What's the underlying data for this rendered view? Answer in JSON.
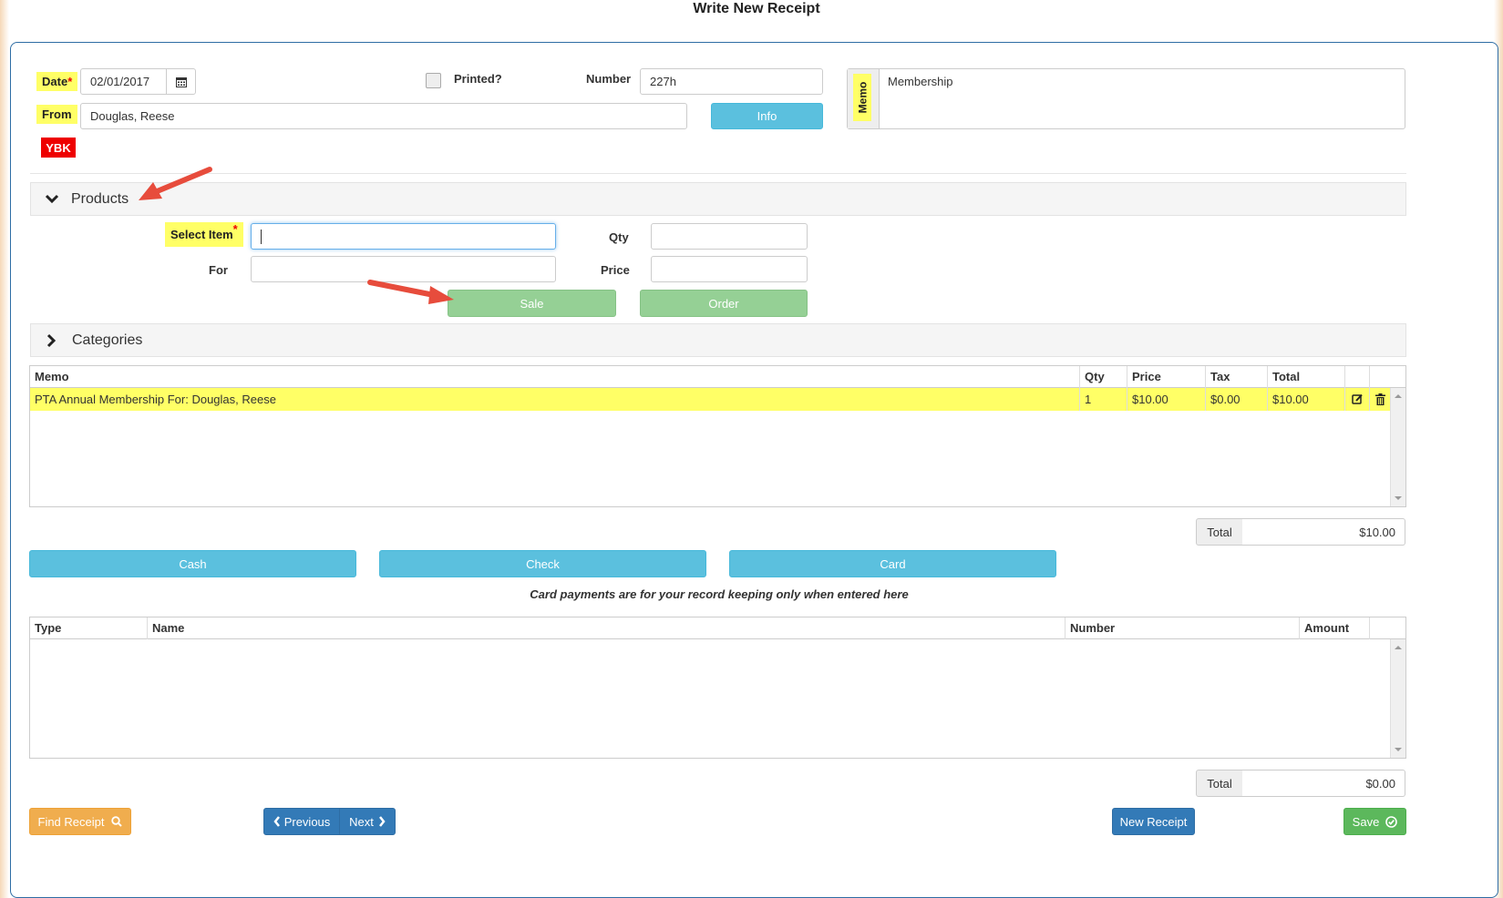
{
  "page": {
    "title": "Write New Receipt"
  },
  "header": {
    "date_label": "Date",
    "date_value": "02/01/2017",
    "from_label": "From",
    "from_value": "Douglas, Reese",
    "badge": "YBK",
    "printed_label": "Printed?",
    "printed_checked": false,
    "number_label": "Number",
    "number_value": "227h",
    "info_button": "Info",
    "memo_label": "Memo",
    "memo_value": "Membership"
  },
  "products": {
    "title": "Products",
    "select_item_label": "Select Item",
    "select_item_value": "",
    "for_label": "For",
    "for_value": "",
    "qty_label": "Qty",
    "qty_value": "",
    "price_label": "Price",
    "price_value": "",
    "sale_button": "Sale",
    "order_button": "Order"
  },
  "categories": {
    "title": "Categories"
  },
  "items_table": {
    "columns": [
      "Memo",
      "Qty",
      "Price",
      "Tax",
      "Total"
    ],
    "rows": [
      {
        "memo": "PTA Annual Membership For: Douglas, Reese",
        "qty": "1",
        "price": "$10.00",
        "tax": "$0.00",
        "total": "$10.00"
      }
    ],
    "total_label": "Total",
    "total_value": "$10.00"
  },
  "payment": {
    "cash_button": "Cash",
    "check_button": "Check",
    "card_button": "Card",
    "note": "Card payments are for your record keeping only when entered here"
  },
  "payments_table": {
    "columns": [
      "Type",
      "Name",
      "Number",
      "Amount"
    ],
    "total_label": "Total",
    "total_value": "$0.00"
  },
  "footer": {
    "find_receipt": "Find Receipt",
    "previous": "Previous",
    "next": "Next",
    "new_receipt": "New Receipt",
    "save": "Save"
  },
  "colors": {
    "highlight": "#ffff66",
    "info": "#5bc0de",
    "sale_green": "#95d095",
    "primary": "#337ab7",
    "success": "#5cb85c",
    "warning": "#f0ad4e",
    "badge_red": "#ee0000",
    "annotation_arrow": "#e74c3c"
  }
}
